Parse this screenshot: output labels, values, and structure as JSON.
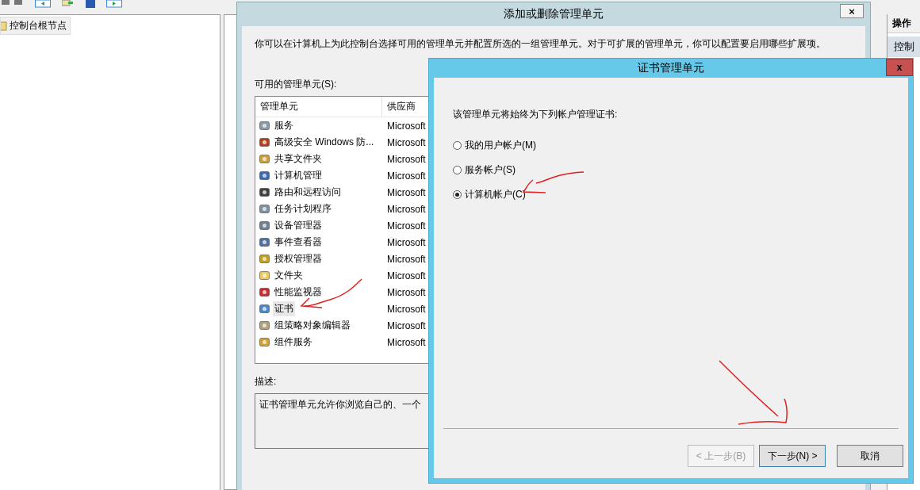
{
  "console": {
    "tree": [
      {
        "label": "控制台根节点",
        "selected": true
      }
    ],
    "actions": {
      "header": "操作",
      "items": [
        "控制"
      ]
    }
  },
  "add_remove_dialog": {
    "title": "添加或删除管理单元",
    "close": "×",
    "intro": "你可以在计算机上为此控制台选择可用的管理单元并配置所选的一组管理单元。对于可扩展的管理单元，你可以配置要启用哪些扩展项。",
    "available_label": "可用的管理单元(S):",
    "columns": [
      "管理单元",
      "供应商"
    ],
    "rows": [
      {
        "name": "服务",
        "vendor": "Microsoft",
        "selected": false
      },
      {
        "name": "高级安全 Windows 防...",
        "vendor": "Microsoft",
        "selected": false
      },
      {
        "name": "共享文件夹",
        "vendor": "Microsoft",
        "selected": false
      },
      {
        "name": "计算机管理",
        "vendor": "Microsoft",
        "selected": false
      },
      {
        "name": "路由和远程访问",
        "vendor": "Microsoft",
        "selected": false
      },
      {
        "name": "任务计划程序",
        "vendor": "Microsoft",
        "selected": false
      },
      {
        "name": "设备管理器",
        "vendor": "Microsoft",
        "selected": false
      },
      {
        "name": "事件查看器",
        "vendor": "Microsoft",
        "selected": false
      },
      {
        "name": "授权管理器",
        "vendor": "Microsoft",
        "selected": false
      },
      {
        "name": "文件夹",
        "vendor": "Microsoft",
        "selected": false
      },
      {
        "name": "性能监视器",
        "vendor": "Microsoft",
        "selected": false
      },
      {
        "name": "证书",
        "vendor": "Microsoft",
        "selected": true
      },
      {
        "name": "组策略对象编辑器",
        "vendor": "Microsoft",
        "selected": false
      },
      {
        "name": "组件服务",
        "vendor": "Microsoft",
        "selected": false
      }
    ],
    "description_label": "描述:",
    "description": "证书管理单元允许你浏览自己的、一个"
  },
  "cert_dialog": {
    "title": "证书管理单元",
    "close": "x",
    "prompt": "该管理单元将始终为下列帐户管理证书:",
    "options": [
      {
        "label": "我的用户帐户(M)",
        "selected": false
      },
      {
        "label": "服务帐户(S)",
        "selected": false
      },
      {
        "label": "计算机帐户(C)",
        "selected": true
      }
    ],
    "buttons": [
      {
        "label": "< 上一步(B)",
        "kind": "back",
        "disabled": true
      },
      {
        "label": "下一步(N) >",
        "kind": "next",
        "disabled": false
      },
      {
        "label": "取消",
        "kind": "cancel",
        "disabled": false
      }
    ]
  }
}
